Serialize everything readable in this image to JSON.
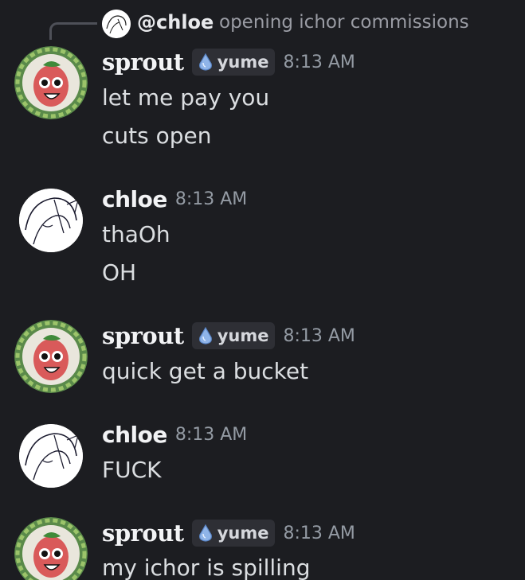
{
  "reply": {
    "name": "@chloe",
    "text": "opening ichor commissions"
  },
  "messages": [
    {
      "author": "sprout",
      "tag": "yume",
      "time": "8:13 AM",
      "lines": [
        "let me pay you",
        "cuts open"
      ]
    },
    {
      "author": "chloe",
      "time": "8:13 AM",
      "lines": [
        "thaOh",
        "OH"
      ]
    },
    {
      "author": "sprout",
      "tag": "yume",
      "time": "8:13 AM",
      "lines": [
        "quick get a bucket"
      ]
    },
    {
      "author": "chloe",
      "time": "8:13 AM",
      "lines": [
        "FUCK"
      ]
    },
    {
      "author": "sprout",
      "tag": "yume",
      "time": "8:13 AM",
      "lines": [
        "my ichor is spilling"
      ]
    }
  ],
  "colors": {
    "background": "#1c1d21",
    "username": "#f2f3f5",
    "timestamp": "#949ba4",
    "tag_background": "#2e2f35",
    "message_text": "#dbdee1"
  }
}
